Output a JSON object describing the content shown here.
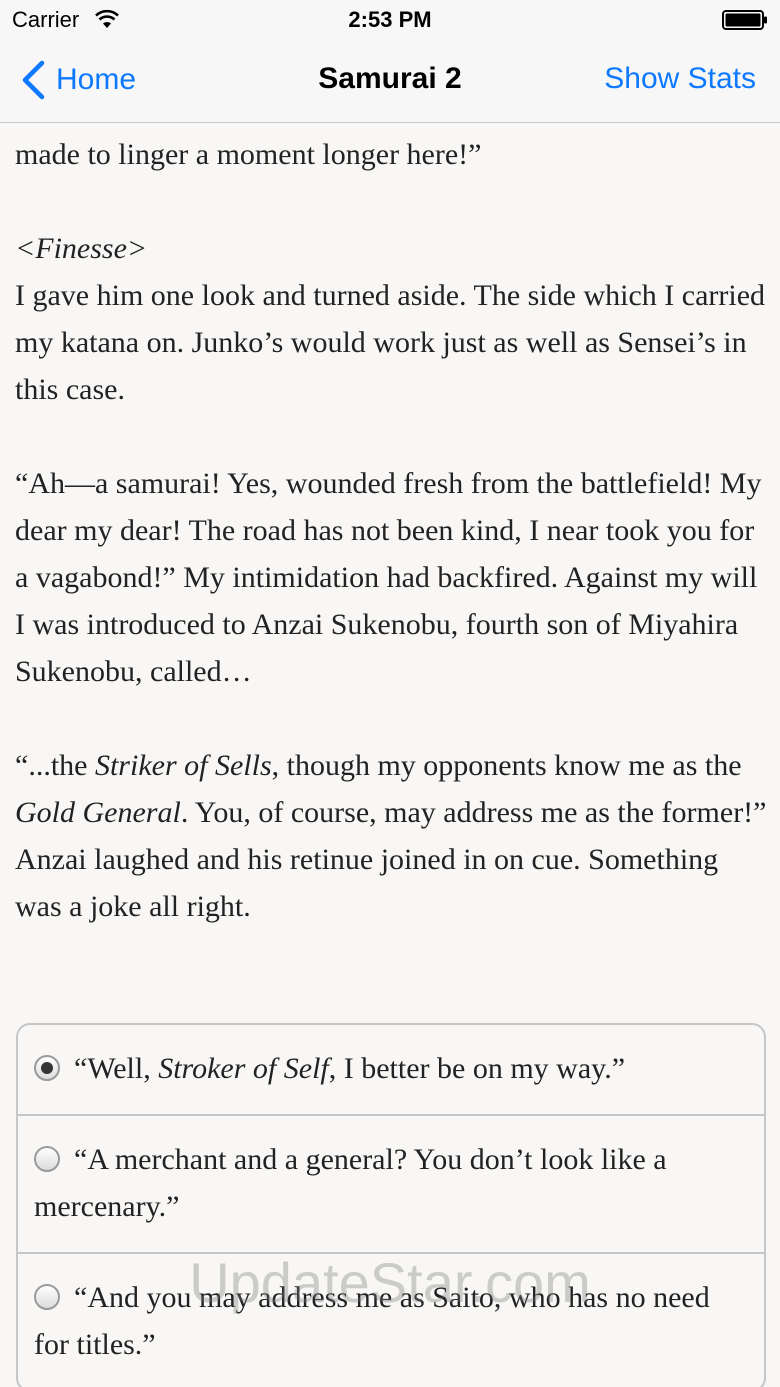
{
  "status_bar": {
    "carrier": "Carrier",
    "time": "2:53 PM"
  },
  "nav": {
    "back_label": "Home",
    "title": "Samurai 2",
    "right_button": "Show Stats",
    "accent_color": "#0d79ff"
  },
  "story": {
    "p1": "made to linger a moment longer here!”",
    "p2_tag": "<Finesse>",
    "p2": "I gave him one look and turned aside. The side which I carried my katana on. Junko’s would work just as well as Sensei’s in this case.",
    "p3": "“Ah—a samurai! Yes, wounded fresh from the battlefield! My dear my dear! The road has not been kind, I near took you for a vagabond!” My intimidation had backfired. Against my will I was introduced to Anzai Sukenobu, fourth son of Miyahira Sukenobu, called…",
    "p4_a": "“...the ",
    "p4_b": "Striker of Sells",
    "p4_c": ", though my opponents know me as the ",
    "p4_d": "Gold General",
    "p4_e": ". You, of course, may address me as the former!” Anzai laughed and his retinue joined in on cue. Something was a joke all right."
  },
  "choices": [
    {
      "a": "“Well, ",
      "b": "Stroker of Self",
      "c": ", I better be on my way.”",
      "selected": true
    },
    {
      "a": "“A merchant and a general? You don’t look like a mercenary.”",
      "selected": false
    },
    {
      "a": "“And you may address me as Saito, who has no need for titles.”",
      "selected": false
    }
  ],
  "watermark": "UpdateStar.com"
}
